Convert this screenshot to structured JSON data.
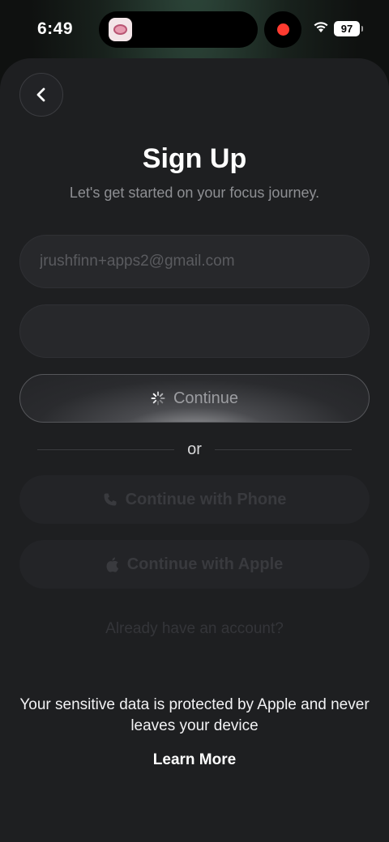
{
  "status_bar": {
    "time": "6:49",
    "battery": "97",
    "recording_color": "#ff3b30"
  },
  "header": {
    "back_icon": "chevron-left-icon",
    "title": "Sign Up",
    "subtitle": "Let's get started on your focus journey."
  },
  "form": {
    "email_placeholder": "jrushfinn+apps2@gmail.com",
    "email_value": "",
    "password_value": "",
    "continue_label": "Continue",
    "continue_state": "loading"
  },
  "divider": {
    "label": "or"
  },
  "alternatives": {
    "phone_label": "Continue with Phone",
    "phone_icon": "phone-icon",
    "apple_label": "Continue with Apple",
    "apple_icon": "apple-logo-icon"
  },
  "footer": {
    "account_link": "Already have an account?",
    "privacy_text": "Your sensitive data is protected by Apple and never leaves your device",
    "learn_more": "Learn More"
  }
}
